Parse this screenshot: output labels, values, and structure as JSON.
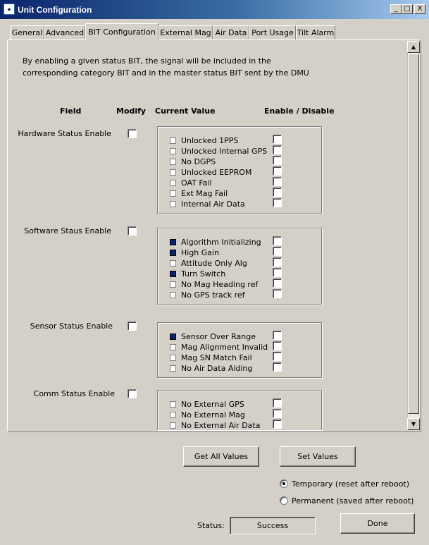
{
  "window": {
    "title": "Unit Configuration",
    "controls": {
      "minimize": "_",
      "maximize": "□",
      "close": "X"
    }
  },
  "tabs": [
    {
      "label": "General",
      "active": false
    },
    {
      "label": "Advanced",
      "active": false
    },
    {
      "label": "BIT Configuration",
      "active": true
    },
    {
      "label": "External Mag",
      "active": false
    },
    {
      "label": "Air Data",
      "active": false
    },
    {
      "label": "Port Usage",
      "active": false
    },
    {
      "label": "Tilt Alarm",
      "active": false
    }
  ],
  "description": "By enabling a given status BIT,  the signal will be included in the corresponding category BIT and in the  master status BIT sent by the DMU",
  "headers": {
    "field": "Field",
    "modify": "Modify",
    "current_value": "Current Value",
    "enable_disable": "Enable / Disable"
  },
  "groups": [
    {
      "label": "Hardware Status Enable",
      "modify": false,
      "items": [
        {
          "label": "Unlocked 1PPS",
          "current": false,
          "enabled": false
        },
        {
          "label": "Unlocked Internal GPS",
          "current": false,
          "enabled": false
        },
        {
          "label": "No DGPS",
          "current": false,
          "enabled": false
        },
        {
          "label": "Unlocked EEPROM",
          "current": false,
          "enabled": false
        },
        {
          "label": "OAT Fail",
          "current": false,
          "enabled": false
        },
        {
          "label": "Ext Mag Fail",
          "current": false,
          "enabled": false
        },
        {
          "label": "Internal Air Data",
          "current": false,
          "enabled": false
        }
      ]
    },
    {
      "label": "Software Staus Enable",
      "modify": false,
      "items": [
        {
          "label": "Algorithm Initializing",
          "current": true,
          "enabled": false
        },
        {
          "label": "High Gain",
          "current": true,
          "enabled": false
        },
        {
          "label": "Attitude Only Alg",
          "current": false,
          "enabled": false
        },
        {
          "label": "Turn Switch",
          "current": true,
          "enabled": false
        },
        {
          "label": "No Mag Heading ref",
          "current": false,
          "enabled": false
        },
        {
          "label": "No GPS track ref",
          "current": false,
          "enabled": false
        }
      ]
    },
    {
      "label": "Sensor Status Enable",
      "modify": false,
      "items": [
        {
          "label": "Sensor Over Range",
          "current": true,
          "enabled": false
        },
        {
          "label": "Mag Alignment Invalid",
          "current": false,
          "enabled": false
        },
        {
          "label": "Mag SN Match Fail",
          "current": false,
          "enabled": false
        },
        {
          "label": "No Air Data Aiding",
          "current": false,
          "enabled": false
        }
      ]
    },
    {
      "label": "Comm Status Enable",
      "modify": false,
      "items": [
        {
          "label": "No External GPS",
          "current": false,
          "enabled": false
        },
        {
          "label": "No External Mag",
          "current": false,
          "enabled": false
        },
        {
          "label": "No External Air Data",
          "current": false,
          "enabled": false
        }
      ]
    }
  ],
  "buttons": {
    "get_all": "Get All Values",
    "set_values": "Set Values",
    "done": "Done"
  },
  "save_mode": {
    "temporary": "Temporary (reset after reboot)",
    "permanent": "Permanent (saved after reboot)",
    "selected": "temporary"
  },
  "status": {
    "label": "Status:",
    "value": "Success"
  },
  "colors": {
    "titlebar_start": "#0a246a",
    "titlebar_end": "#a6caf0",
    "indicator_on": "#0a246a",
    "face": "#d4d0c8"
  }
}
